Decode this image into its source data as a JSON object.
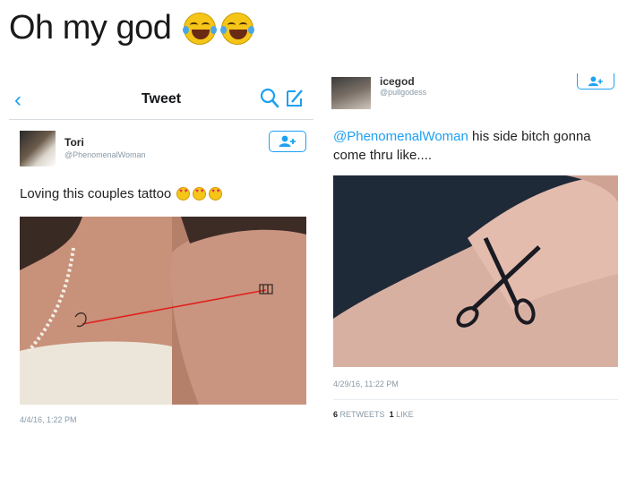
{
  "caption": {
    "text": "Oh my god",
    "emoji": [
      "face-with-tears-of-joy",
      "face-with-tears-of-joy"
    ]
  },
  "left_tweet": {
    "nav": {
      "back_icon": "chevron-left-icon",
      "title": "Tweet",
      "search_icon": "search-icon",
      "compose_icon": "compose-icon"
    },
    "author": {
      "name": "Tori",
      "handle": "@PhenomenalWoman"
    },
    "follow_icon": "add-user-icon",
    "text": "Loving this couples tattoo",
    "text_emoji": [
      "heart-eyes",
      "heart-eyes",
      "heart-eyes"
    ],
    "image": "couple-string-tattoo-photo",
    "timestamp": "4/4/16, 1:22 PM"
  },
  "right_tweet": {
    "author": {
      "name": "icegod",
      "handle": "@pullgodess"
    },
    "follow_icon": "add-user-icon",
    "mention": "@PhenomenalWoman",
    "text": " his side bitch gonna come thru like....",
    "image": "scissors-wrist-tattoo-photo",
    "timestamp": "4/29/16, 11:22 PM",
    "retweets": "6",
    "retweets_label": "RETWEETS",
    "likes": "1",
    "likes_label": "LIKE"
  },
  "colors": {
    "accent": "#1da1f2",
    "muted": "#8899a6"
  }
}
